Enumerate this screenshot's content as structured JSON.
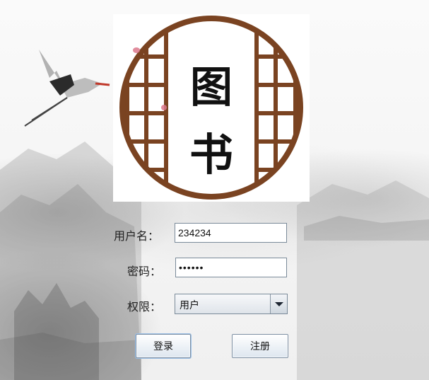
{
  "logo": {
    "char_top": "图",
    "char_bottom": "书",
    "frame_color": "#7a4321"
  },
  "form": {
    "username_label": "用户名：",
    "username_value": "234234",
    "password_label": "密码：",
    "password_value": "••••••",
    "role_label": "权限：",
    "role_selected": "用户"
  },
  "buttons": {
    "login_label": "登录",
    "register_label": "注册"
  }
}
